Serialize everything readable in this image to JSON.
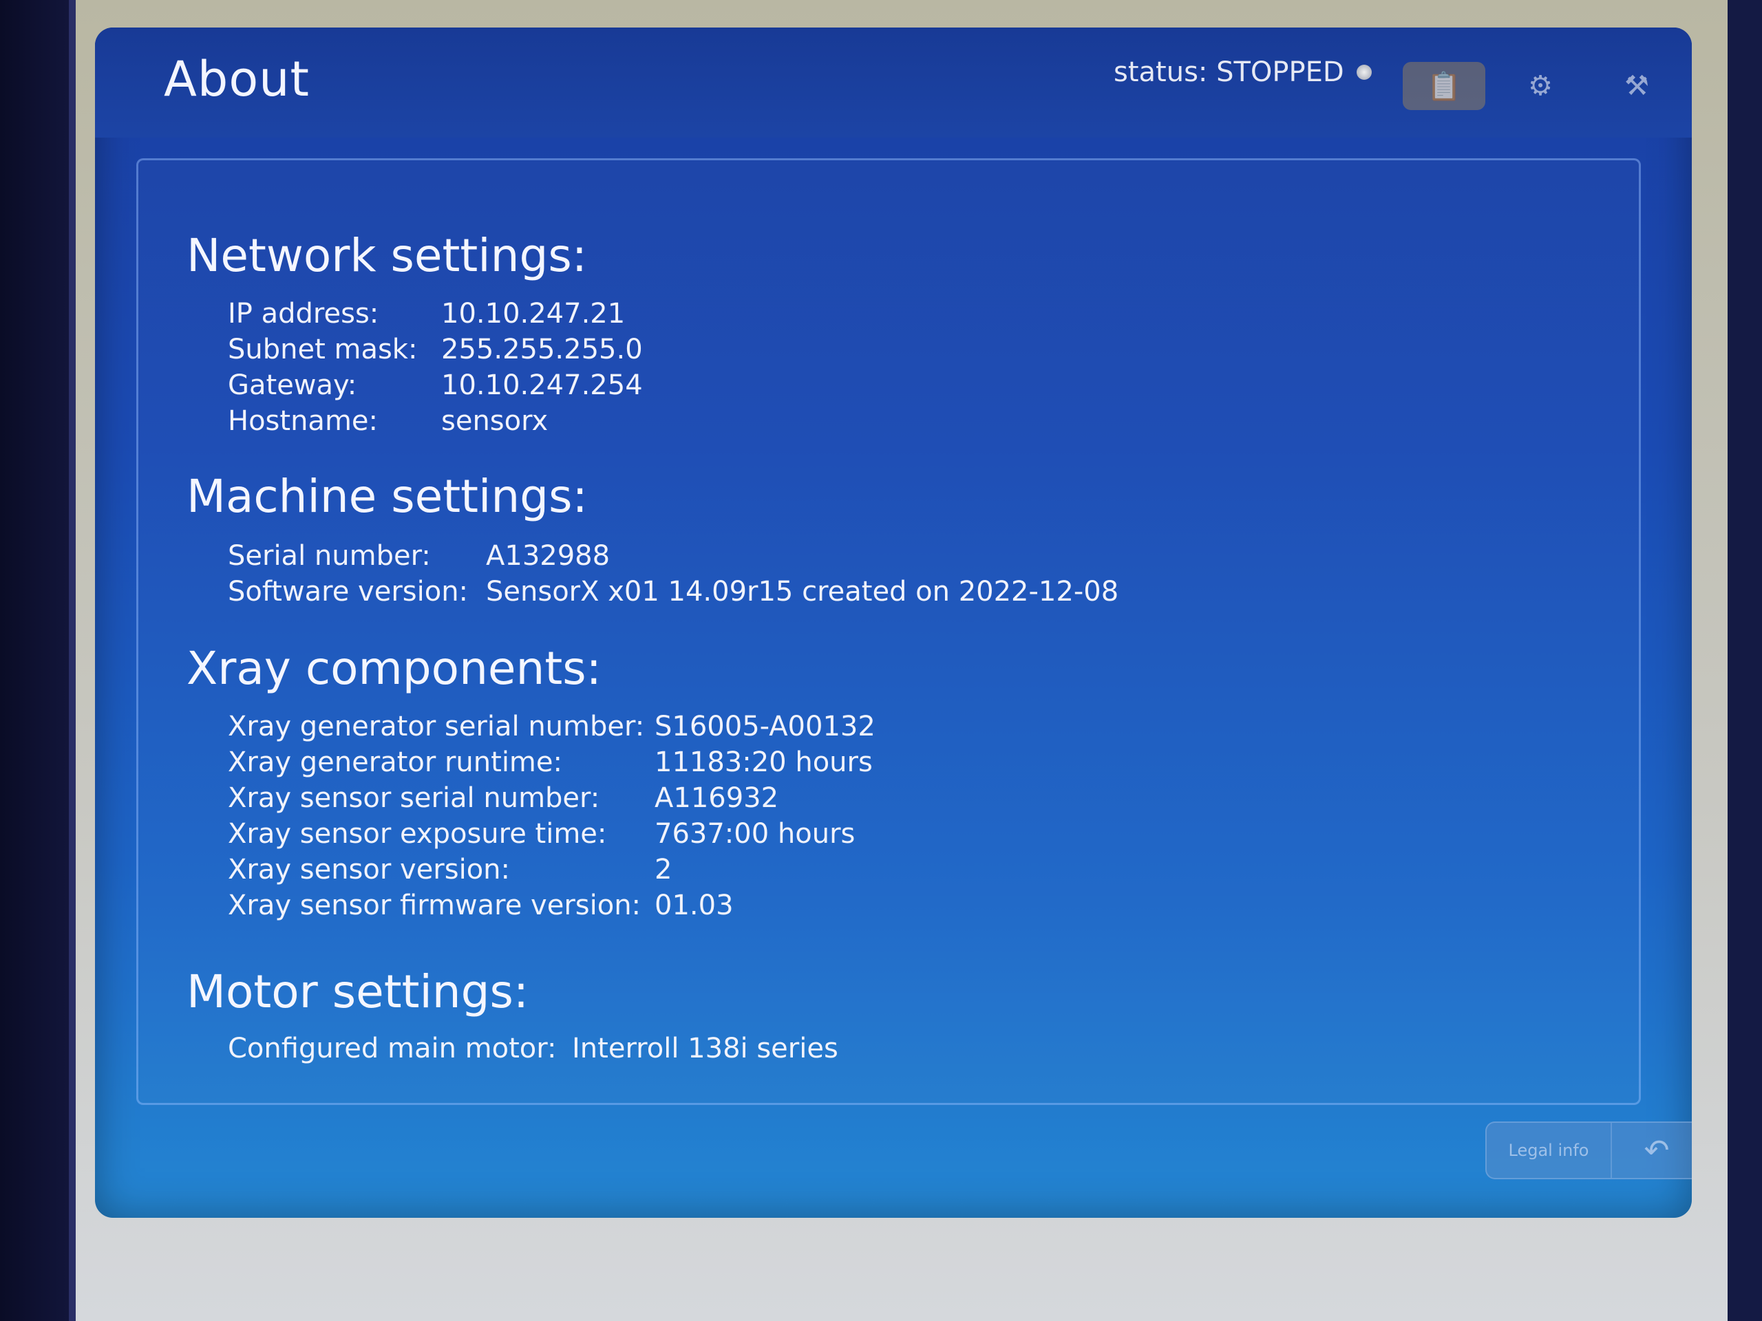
{
  "header": {
    "title": "About",
    "status_text": "status: STOPPED",
    "icons": [
      "clipboard-icon",
      "gear-icon",
      "tools-icon"
    ]
  },
  "network": {
    "title": "Network settings:",
    "rows": [
      {
        "label": "IP address:",
        "value": "10.10.247.21"
      },
      {
        "label": "Subnet mask:",
        "value": "255.255.255.0"
      },
      {
        "label": "Gateway:",
        "value": "10.10.247.254"
      },
      {
        "label": "Hostname:",
        "value": "sensorx"
      }
    ]
  },
  "machine": {
    "title": "Machine settings:",
    "rows": [
      {
        "label": "Serial number:",
        "value": "A132988"
      },
      {
        "label": "Software version:",
        "value": "SensorX x01 14.09r15 created on 2022-12-08"
      }
    ]
  },
  "xray": {
    "title": "Xray components:",
    "rows": [
      {
        "label": "Xray generator serial number:",
        "value": "S16005-A00132"
      },
      {
        "label": "Xray generator runtime:",
        "value": "11183:20 hours"
      },
      {
        "label": "Xray sensor serial number:",
        "value": "A116932"
      },
      {
        "label": "Xray sensor exposure time:",
        "value": "7637:00 hours"
      },
      {
        "label": "Xray sensor version:",
        "value": "2"
      },
      {
        "label": "Xray sensor firmware version:",
        "value": "01.03"
      }
    ]
  },
  "motor": {
    "title": "Motor settings:",
    "rows": [
      {
        "label": "Configured main motor:",
        "value": "Interroll 138i series"
      }
    ]
  },
  "footer": {
    "legal_label": "Legal info",
    "back_icon": "back-arrow-icon"
  }
}
